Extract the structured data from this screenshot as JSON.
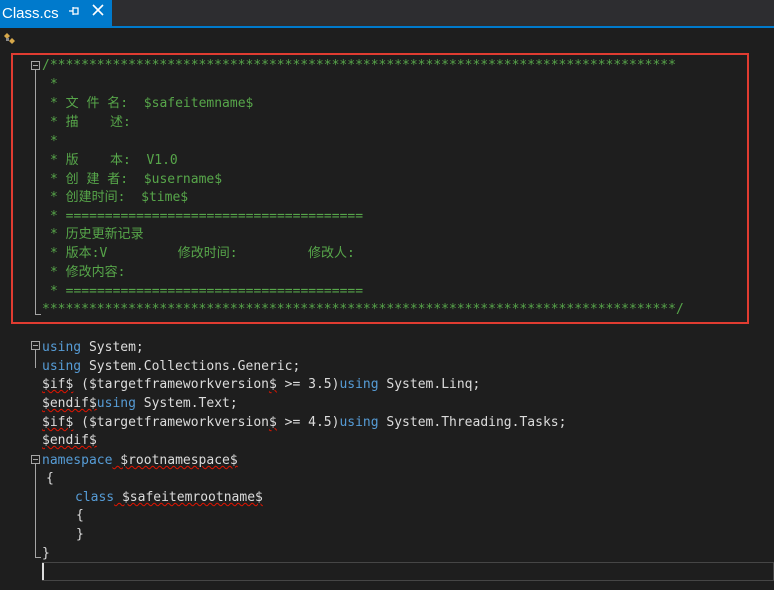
{
  "tab": {
    "title": "Class.cs",
    "pin_icon": "pin-icon",
    "close_icon": "close-icon"
  },
  "comment": {
    "top": "/********************************************************************************",
    "star": "*",
    "filename": "* 文 件 名:  $safeitemname$",
    "desc": "* 描    述:",
    "version": "* 版    本:  V1.0",
    "creator": "* 创 建 者:  $username$",
    "created": "* 创建时间:  $time$",
    "sep": "* ======================================",
    "history": "* 历史更新记录",
    "hist_cols": "* 版本:V         修改时间:         修改人:",
    "change": "* 修改内容:",
    "sep2": "* ======================================",
    "bottom": "*********************************************************************************/"
  },
  "code": {
    "l1_kw": "using",
    "l1_rest": " System;",
    "l2_kw": "using",
    "l2_rest": " System.Collections.Generic;",
    "l3_a": "$if$",
    "l3_b": " ($targetframeworkversion",
    "l3_c": "$",
    "l3_d": " >= 3.5)",
    "l3_kw": "using",
    "l3_rest": " System.Linq;",
    "l4_a": "$endif$",
    "l4_kw": "using",
    "l4_rest": " System.Text;",
    "l5_a": "$if$",
    "l5_b": " ($targetframeworkversion",
    "l5_c": "$",
    "l5_d": " >= 4.5)",
    "l5_kw": "using",
    "l5_rest": " System.Threading.Tasks;",
    "l6": "$endif$",
    "l7_kw": "namespace",
    "l7_rest": " $rootnamespace$",
    "l8": "{",
    "l9_kw": "class",
    "l9_rest": " $safeitemrootname$",
    "l10": "{",
    "l11": "}",
    "l12": "}"
  },
  "colors": {
    "comment": "#57a64a",
    "keyword": "#569cd6",
    "text": "#dcdcdc",
    "accent": "#007acc",
    "highlight_box": "#e03c31"
  }
}
